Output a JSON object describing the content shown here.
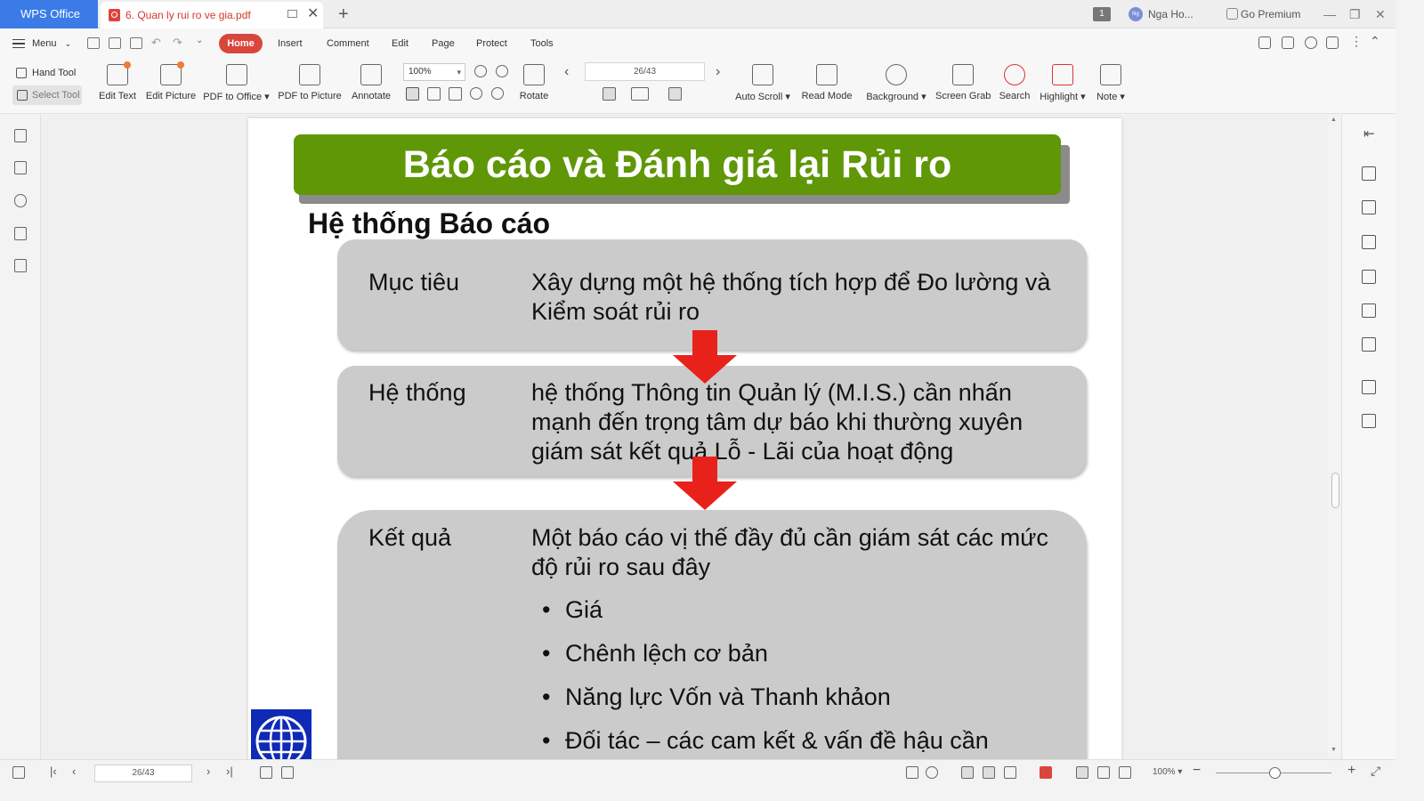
{
  "titlebar": {
    "app_name": "WPS Office",
    "doc_tab_title": "6. Quan ly rui ro ve gia.pdf",
    "notification_count": "1",
    "user_initials": "Ng",
    "user_name": "Nga Ho...",
    "premium_label": "Go Premium"
  },
  "menu": {
    "menu_label": "Menu",
    "tabs": [
      "Home",
      "Insert",
      "Comment",
      "Edit",
      "Page",
      "Protect",
      "Tools"
    ],
    "active_tab": "Home"
  },
  "ribbon": {
    "hand_tool": "Hand Tool",
    "select_tool": "Select Tool",
    "edit_text": "Edit Text",
    "edit_picture": "Edit Picture",
    "pdf_to_office": "PDF to Office",
    "pdf_to_picture": "PDF to Picture",
    "annotate": "Annotate",
    "zoom_value": "100%",
    "rotate": "Rotate",
    "page_indicator": "26/43",
    "auto_scroll": "Auto Scroll",
    "read_mode": "Read Mode",
    "background": "Background",
    "screen_grab": "Screen Grab",
    "search": "Search",
    "highlight": "Highlight",
    "note": "Note"
  },
  "document": {
    "slide_title": "Báo cáo và Đánh giá lại Rủi ro",
    "section_title": "Hệ thống Báo cáo",
    "boxes": [
      {
        "label": "Mục tiêu",
        "text": "Xây dựng một hệ thống tích hợp để Đo lường và Kiểm soát rủi ro"
      },
      {
        "label": "Hệ thống",
        "text": "hệ thống Thông tin Quản lý (M.I.S.) cần nhấn mạnh đến trọng tâm dự báo khi thường xuyên giám sát kết quả Lỗ - Lãi của hoạt động"
      },
      {
        "label": "Kết quả",
        "text": "Một báo cáo vị thế đầy đủ cần giám sát các mức độ rủi ro sau đây",
        "bullets": [
          "Giá",
          "Chênh lệch cơ bản",
          "Năng lực Vốn và Thanh khảon",
          "Đối tác – các cam kết & vấn đề hậu cần"
        ]
      }
    ],
    "arrow_color": "#e8221b",
    "banner_color": "#5f9707"
  },
  "statusbar": {
    "page_indicator": "26/43",
    "zoom_percent": "100%"
  },
  "colors": {
    "accent": "#d9463c",
    "app_tab": "#3b7be7"
  }
}
